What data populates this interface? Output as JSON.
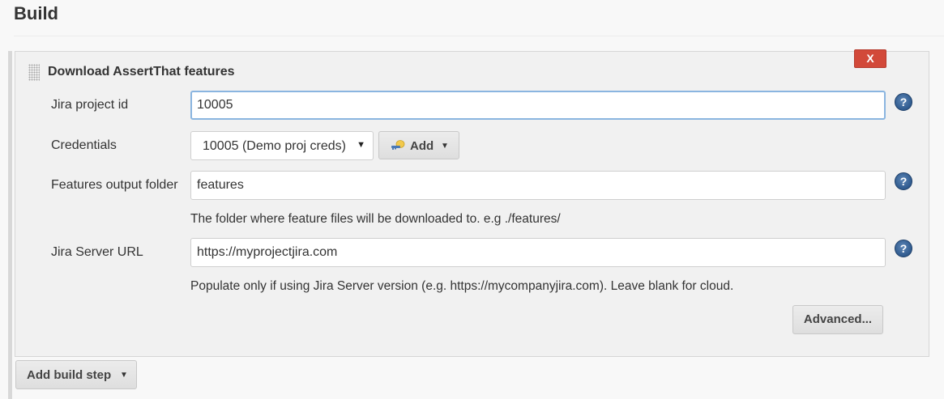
{
  "section": {
    "title": "Build"
  },
  "build_step": {
    "title": "Download AssertThat features",
    "delete_label": "X",
    "fields": {
      "project_id": {
        "label": "Jira project id",
        "value": "10005"
      },
      "credentials": {
        "label": "Credentials",
        "selected": "10005 (Demo proj creds)",
        "add_label": "Add"
      },
      "output_folder": {
        "label": "Features output folder",
        "value": "features",
        "description": "The folder where feature files will be downloaded to. e.g ./features/"
      },
      "server_url": {
        "label": "Jira Server URL",
        "value": "https://myprojectjira.com",
        "description": "Populate only if using Jira Server version (e.g. https://mycompanyjira.com). Leave blank for cloud."
      }
    },
    "help_glyph": "?",
    "advanced_label": "Advanced..."
  },
  "footer": {
    "add_build_step_label": "Add build step"
  },
  "icons": {
    "help": "help-icon",
    "key": "key-icon",
    "caret": "caret-down-icon",
    "drag": "drag-handle-icon"
  },
  "colors": {
    "delete_button": "#d24939",
    "focus_border": "#8ab5e0",
    "help_icon": "#2f5a8e",
    "panel_background": "#f1f1f1"
  }
}
